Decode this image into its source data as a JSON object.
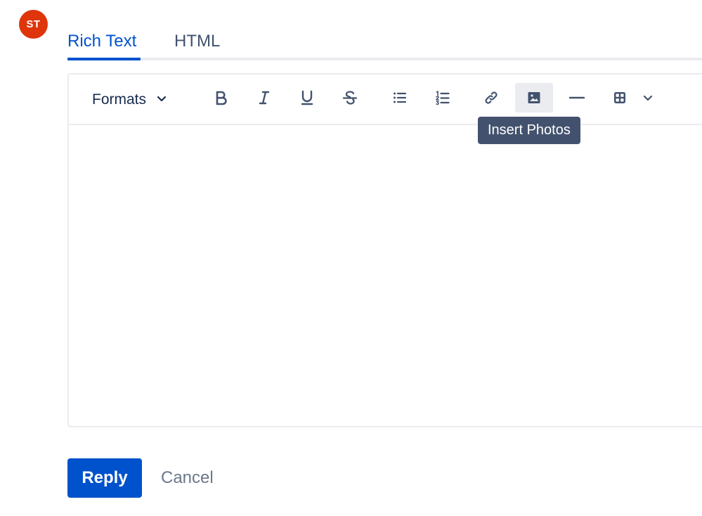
{
  "avatar": {
    "initials": "ST",
    "color": "#de350b"
  },
  "tabs": [
    {
      "label": "Rich Text",
      "active": true
    },
    {
      "label": "HTML",
      "active": false
    }
  ],
  "toolbar": {
    "formats_label": "Formats",
    "buttons": [
      {
        "name": "bold",
        "icon": "bold-icon"
      },
      {
        "name": "italic",
        "icon": "italic-icon"
      },
      {
        "name": "underline",
        "icon": "underline-icon"
      },
      {
        "name": "strikethrough",
        "icon": "strikethrough-icon"
      },
      {
        "name": "bullet-list",
        "icon": "bullet-list-icon"
      },
      {
        "name": "numbered-list",
        "icon": "numbered-list-icon"
      },
      {
        "name": "link",
        "icon": "link-icon"
      },
      {
        "name": "insert-photos",
        "icon": "image-icon",
        "hovered": true
      },
      {
        "name": "horizontal-rule",
        "icon": "horizontal-rule-icon"
      },
      {
        "name": "table",
        "icon": "table-icon"
      },
      {
        "name": "more",
        "icon": "chevron-down-icon"
      }
    ]
  },
  "tooltip": {
    "text": "Insert Photos"
  },
  "actions": {
    "reply_label": "Reply",
    "cancel_label": "Cancel"
  },
  "colors": {
    "primary": "#0052cc",
    "text": "#172b4d",
    "icon": "#42526e",
    "border": "#ebecf0",
    "muted": "#6b778c",
    "tooltip_bg": "#42526e"
  }
}
